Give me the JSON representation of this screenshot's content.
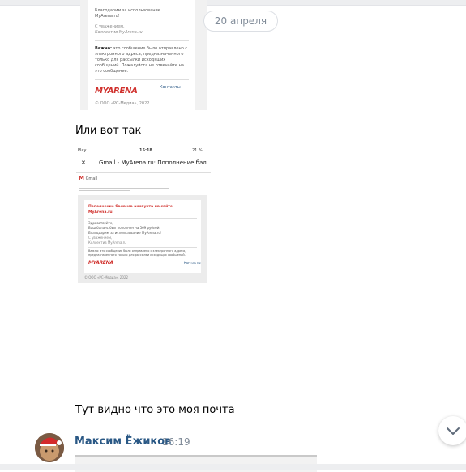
{
  "date_divider": "20 апреля",
  "attachment_top": {
    "line1": "Благодарим за использование",
    "line2": "MyArena.ru!",
    "regards": "С уважением,",
    "team": "Коллектив MyArena.ru",
    "warning_bold": "Важно:",
    "warning": "это сообщение было отправлено с электронного адреса, предназначенного только для рассылки исходящих сообщений. Пожалуйста не отвечайте на это сообщение.",
    "logo": "MYARENA",
    "contacts": "Контакты",
    "copyright": "© ООО «РС-Медиа», 2022"
  },
  "messages": {
    "msg1": "Или вот так",
    "msg2": "Тут видно что это моя почта"
  },
  "attachment_mid": {
    "carrier": "Play",
    "clock": "15:18",
    "battery": "21 %",
    "close": "✕",
    "subject": "Gmail - MyArena.ru: Пополнение бал...",
    "gmail": "Gmail",
    "heading": "Пополнение баланса аккаунта на сайте MyArena.ru",
    "hello": "Здравствуйте,",
    "topup": "Ваш баланс был пополнен на 569 рублей.",
    "thanks": "Благодарим за использование MyArena.ru!",
    "regards": "С уважением,",
    "team": "Коллектив MyArena.ru",
    "warning": "Важно: это сообщение было отправлено с электронного адреса, предназначенного только для рассылки исходящих сообщений.",
    "logo": "MYARENA",
    "contacts": "Контакты",
    "copyright": "© ООО «РС-Медиа», 2022"
  },
  "author": {
    "name": "Максим Ёжиков",
    "time": "16:19"
  },
  "icons": {
    "scroll_down": "chevron-down-icon"
  }
}
